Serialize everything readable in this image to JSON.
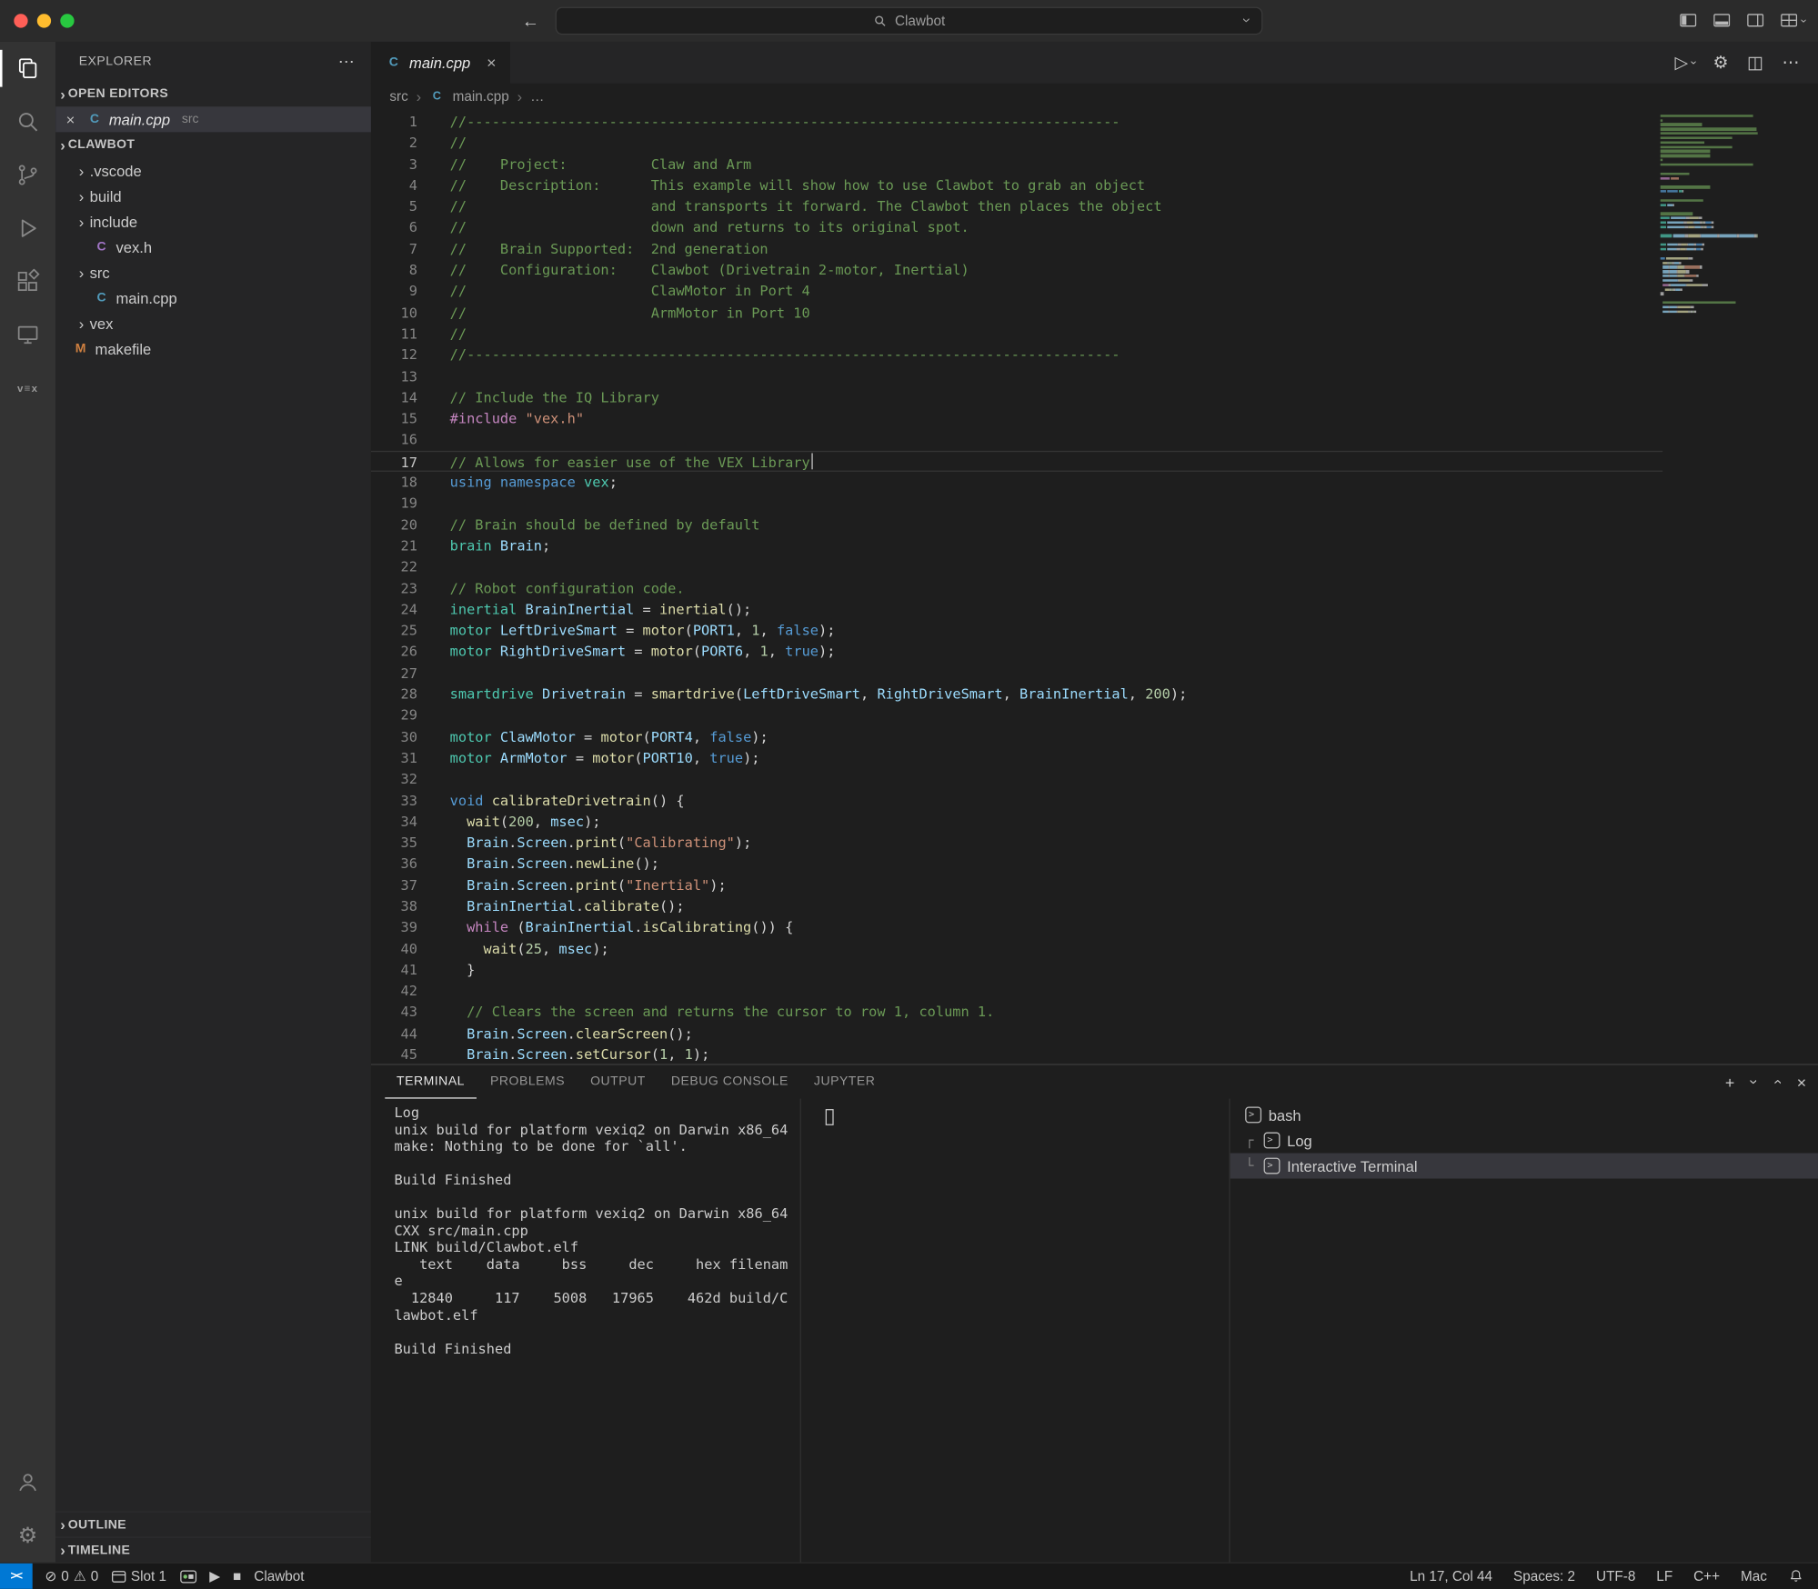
{
  "titlebar": {
    "search": "Clawbot"
  },
  "icons": {
    "chevron": "›",
    "close": "×",
    "ellipsis": "⋯",
    "back": "←",
    "forward": "→",
    "error": "⊘",
    "warning": "⚠",
    "gear": "⚙",
    "play": "▶",
    "stop": "■",
    "plus": "+",
    "split": "◫",
    "run": "▷",
    "vex": "v≡x",
    "prompt": ">"
  },
  "file_icon_letters": {
    "cpp": "C",
    "h": "C",
    "make": "M"
  },
  "colors": {
    "statusbar_bg": "#181818",
    "accent": "#0078d4",
    "selection": "#37373d",
    "comment": "#6A9955",
    "keyword": "#569CD6",
    "control": "#C586C0",
    "type": "#4EC9B0",
    "variable": "#9CDCFE",
    "function": "#DCDCAA",
    "number": "#B5CEA8",
    "string": "#CE9178",
    "traffic_red": "#ff5f57",
    "traffic_yellow": "#febc2e",
    "traffic_green": "#28c840"
  },
  "sidebar": {
    "title": "EXPLORER",
    "open_editors_label": "OPEN EDITORS",
    "open_editor": {
      "name": "main.cpp",
      "detail": "src"
    },
    "project": "CLAWBOT",
    "tree": [
      {
        "kind": "folder",
        "label": ".vscode",
        "depth": 1,
        "open": false
      },
      {
        "kind": "folder",
        "label": "build",
        "depth": 1,
        "open": false
      },
      {
        "kind": "folder",
        "label": "include",
        "depth": 1,
        "open": true
      },
      {
        "kind": "file",
        "label": "vex.h",
        "depth": 2,
        "icon": "h"
      },
      {
        "kind": "folder",
        "label": "src",
        "depth": 1,
        "open": true
      },
      {
        "kind": "file",
        "label": "main.cpp",
        "depth": 2,
        "icon": "cpp"
      },
      {
        "kind": "folder",
        "label": "vex",
        "depth": 1,
        "open": false
      },
      {
        "kind": "file",
        "label": "makefile",
        "depth": 1,
        "icon": "make"
      }
    ],
    "bottom_sections": [
      "OUTLINE",
      "TIMELINE"
    ]
  },
  "editor": {
    "tab_name": "main.cpp",
    "breadcrumb": [
      "src",
      "main.cpp",
      "…"
    ],
    "current_line": 17,
    "code": [
      {
        "n": 1,
        "s": [
          [
            "c",
            "//------------------------------------------------------------------------------"
          ]
        ]
      },
      {
        "n": 2,
        "s": [
          [
            "c",
            "//"
          ]
        ]
      },
      {
        "n": 3,
        "s": [
          [
            "c",
            "//    Project:          Claw and Arm"
          ]
        ]
      },
      {
        "n": 4,
        "s": [
          [
            "c",
            "//    Description:      This example will show how to use Clawbot to grab an object"
          ]
        ]
      },
      {
        "n": 5,
        "s": [
          [
            "c",
            "//                      and transports it forward. The Clawbot then places the object"
          ]
        ]
      },
      {
        "n": 6,
        "s": [
          [
            "c",
            "//                      down and returns to its original spot."
          ]
        ]
      },
      {
        "n": 7,
        "s": [
          [
            "c",
            "//    Brain Supported:  2nd generation"
          ]
        ]
      },
      {
        "n": 8,
        "s": [
          [
            "c",
            "//    Configuration:    Clawbot (Drivetrain 2-motor, Inertial)"
          ]
        ]
      },
      {
        "n": 9,
        "s": [
          [
            "c",
            "//                      ClawMotor in Port 4"
          ]
        ]
      },
      {
        "n": 10,
        "s": [
          [
            "c",
            "//                      ArmMotor in Port 10"
          ]
        ]
      },
      {
        "n": 11,
        "s": [
          [
            "c",
            "//"
          ]
        ]
      },
      {
        "n": 12,
        "s": [
          [
            "c",
            "//------------------------------------------------------------------------------"
          ]
        ]
      },
      {
        "n": 13,
        "s": []
      },
      {
        "n": 14,
        "s": [
          [
            "c",
            "// Include the IQ Library"
          ]
        ]
      },
      {
        "n": 15,
        "s": [
          [
            "p",
            "#include"
          ],
          [
            "d",
            " "
          ],
          [
            "s",
            "\"vex.h\""
          ]
        ]
      },
      {
        "n": 16,
        "s": []
      },
      {
        "n": 17,
        "s": [
          [
            "c",
            "// Allows for easier use of the VEX Library"
          ]
        ]
      },
      {
        "n": 18,
        "s": [
          [
            "k",
            "using"
          ],
          [
            "d",
            " "
          ],
          [
            "k",
            "namespace"
          ],
          [
            "d",
            " "
          ],
          [
            "t",
            "vex"
          ],
          [
            "d",
            ";"
          ]
        ]
      },
      {
        "n": 19,
        "s": []
      },
      {
        "n": 20,
        "s": [
          [
            "c",
            "// Brain should be defined by default"
          ]
        ]
      },
      {
        "n": 21,
        "s": [
          [
            "t",
            "brain"
          ],
          [
            "d",
            " "
          ],
          [
            "v",
            "Brain"
          ],
          [
            "d",
            ";"
          ]
        ]
      },
      {
        "n": 22,
        "s": []
      },
      {
        "n": 23,
        "s": [
          [
            "c",
            "// Robot configuration code."
          ]
        ]
      },
      {
        "n": 24,
        "s": [
          [
            "t",
            "inertial"
          ],
          [
            "d",
            " "
          ],
          [
            "v",
            "BrainInertial"
          ],
          [
            "d",
            " = "
          ],
          [
            "f",
            "inertial"
          ],
          [
            "d",
            "();"
          ]
        ]
      },
      {
        "n": 25,
        "s": [
          [
            "t",
            "motor"
          ],
          [
            "d",
            " "
          ],
          [
            "v",
            "LeftDriveSmart"
          ],
          [
            "d",
            " = "
          ],
          [
            "f",
            "motor"
          ],
          [
            "d",
            "("
          ],
          [
            "v",
            "PORT1"
          ],
          [
            "d",
            ", "
          ],
          [
            "n",
            "1"
          ],
          [
            "d",
            ", "
          ],
          [
            "k",
            "false"
          ],
          [
            "d",
            ");"
          ]
        ]
      },
      {
        "n": 26,
        "s": [
          [
            "t",
            "motor"
          ],
          [
            "d",
            " "
          ],
          [
            "v",
            "RightDriveSmart"
          ],
          [
            "d",
            " = "
          ],
          [
            "f",
            "motor"
          ],
          [
            "d",
            "("
          ],
          [
            "v",
            "PORT6"
          ],
          [
            "d",
            ", "
          ],
          [
            "n",
            "1"
          ],
          [
            "d",
            ", "
          ],
          [
            "k",
            "true"
          ],
          [
            "d",
            ");"
          ]
        ]
      },
      {
        "n": 27,
        "s": []
      },
      {
        "n": 28,
        "s": [
          [
            "t",
            "smartdrive"
          ],
          [
            "d",
            " "
          ],
          [
            "v",
            "Drivetrain"
          ],
          [
            "d",
            " = "
          ],
          [
            "f",
            "smartdrive"
          ],
          [
            "d",
            "("
          ],
          [
            "v",
            "LeftDriveSmart"
          ],
          [
            "d",
            ", "
          ],
          [
            "v",
            "RightDriveSmart"
          ],
          [
            "d",
            ", "
          ],
          [
            "v",
            "BrainInertial"
          ],
          [
            "d",
            ", "
          ],
          [
            "n",
            "200"
          ],
          [
            "d",
            ");"
          ]
        ]
      },
      {
        "n": 29,
        "s": []
      },
      {
        "n": 30,
        "s": [
          [
            "t",
            "motor"
          ],
          [
            "d",
            " "
          ],
          [
            "v",
            "ClawMotor"
          ],
          [
            "d",
            " = "
          ],
          [
            "f",
            "motor"
          ],
          [
            "d",
            "("
          ],
          [
            "v",
            "PORT4"
          ],
          [
            "d",
            ", "
          ],
          [
            "k",
            "false"
          ],
          [
            "d",
            ");"
          ]
        ]
      },
      {
        "n": 31,
        "s": [
          [
            "t",
            "motor"
          ],
          [
            "d",
            " "
          ],
          [
            "v",
            "ArmMotor"
          ],
          [
            "d",
            " = "
          ],
          [
            "f",
            "motor"
          ],
          [
            "d",
            "("
          ],
          [
            "v",
            "PORT10"
          ],
          [
            "d",
            ", "
          ],
          [
            "k",
            "true"
          ],
          [
            "d",
            ");"
          ]
        ]
      },
      {
        "n": 32,
        "s": []
      },
      {
        "n": 33,
        "s": [
          [
            "k",
            "void"
          ],
          [
            "d",
            " "
          ],
          [
            "f",
            "calibrateDrivetrain"
          ],
          [
            "d",
            "() {"
          ]
        ]
      },
      {
        "n": 34,
        "s": [
          [
            "d",
            "  "
          ],
          [
            "f",
            "wait"
          ],
          [
            "d",
            "("
          ],
          [
            "n",
            "200"
          ],
          [
            "d",
            ", "
          ],
          [
            "v",
            "msec"
          ],
          [
            "d",
            ");"
          ]
        ]
      },
      {
        "n": 35,
        "s": [
          [
            "d",
            "  "
          ],
          [
            "v",
            "Brain"
          ],
          [
            "d",
            "."
          ],
          [
            "v",
            "Screen"
          ],
          [
            "d",
            "."
          ],
          [
            "f",
            "print"
          ],
          [
            "d",
            "("
          ],
          [
            "s",
            "\"Calibrating\""
          ],
          [
            "d",
            ");"
          ]
        ]
      },
      {
        "n": 36,
        "s": [
          [
            "d",
            "  "
          ],
          [
            "v",
            "Brain"
          ],
          [
            "d",
            "."
          ],
          [
            "v",
            "Screen"
          ],
          [
            "d",
            "."
          ],
          [
            "f",
            "newLine"
          ],
          [
            "d",
            "();"
          ]
        ]
      },
      {
        "n": 37,
        "s": [
          [
            "d",
            "  "
          ],
          [
            "v",
            "Brain"
          ],
          [
            "d",
            "."
          ],
          [
            "v",
            "Screen"
          ],
          [
            "d",
            "."
          ],
          [
            "f",
            "print"
          ],
          [
            "d",
            "("
          ],
          [
            "s",
            "\"Inertial\""
          ],
          [
            "d",
            ");"
          ]
        ]
      },
      {
        "n": 38,
        "s": [
          [
            "d",
            "  "
          ],
          [
            "v",
            "BrainInertial"
          ],
          [
            "d",
            "."
          ],
          [
            "f",
            "calibrate"
          ],
          [
            "d",
            "();"
          ]
        ]
      },
      {
        "n": 39,
        "s": [
          [
            "d",
            "  "
          ],
          [
            "p",
            "while"
          ],
          [
            "d",
            " ("
          ],
          [
            "v",
            "BrainInertial"
          ],
          [
            "d",
            "."
          ],
          [
            "f",
            "isCalibrating"
          ],
          [
            "d",
            "()) {"
          ]
        ]
      },
      {
        "n": 40,
        "s": [
          [
            "d",
            "    "
          ],
          [
            "f",
            "wait"
          ],
          [
            "d",
            "("
          ],
          [
            "n",
            "25"
          ],
          [
            "d",
            ", "
          ],
          [
            "v",
            "msec"
          ],
          [
            "d",
            ");"
          ]
        ]
      },
      {
        "n": 41,
        "s": [
          [
            "d",
            "  }"
          ]
        ]
      },
      {
        "n": 42,
        "s": []
      },
      {
        "n": 43,
        "s": [
          [
            "d",
            "  "
          ],
          [
            "c",
            "// Clears the screen and returns the cursor to row 1, column 1."
          ]
        ]
      },
      {
        "n": 44,
        "s": [
          [
            "d",
            "  "
          ],
          [
            "v",
            "Brain"
          ],
          [
            "d",
            "."
          ],
          [
            "v",
            "Screen"
          ],
          [
            "d",
            "."
          ],
          [
            "f",
            "clearScreen"
          ],
          [
            "d",
            "();"
          ]
        ]
      },
      {
        "n": 45,
        "s": [
          [
            "d",
            "  "
          ],
          [
            "v",
            "Brain"
          ],
          [
            "d",
            "."
          ],
          [
            "v",
            "Screen"
          ],
          [
            "d",
            "."
          ],
          [
            "f",
            "setCursor"
          ],
          [
            "d",
            "("
          ],
          [
            "n",
            "1"
          ],
          [
            "d",
            ", "
          ],
          [
            "n",
            "1"
          ],
          [
            "d",
            ");"
          ]
        ]
      }
    ]
  },
  "panel": {
    "tabs": [
      "TERMINAL",
      "PROBLEMS",
      "OUTPUT",
      "DEBUG CONSOLE",
      "JUPYTER"
    ],
    "active_tab": "TERMINAL",
    "terminal_lines": [
      "Log",
      "unix build for platform vexiq2 on Darwin x86_64",
      "make: Nothing to be done for `all'.",
      "",
      "Build Finished",
      "",
      "unix build for platform vexiq2 on Darwin x86_64",
      "CXX src/main.cpp",
      "LINK build/Clawbot.elf",
      "   text    data     bss     dec     hex filenam",
      "e",
      "  12840     117    5008   17965    462d build/C",
      "lawbot.elf",
      "",
      "Build Finished"
    ],
    "terminals": [
      {
        "label": "bash",
        "prefix": "",
        "selected": false
      },
      {
        "label": "Log",
        "prefix": "┌",
        "selected": false
      },
      {
        "label": "Interactive Terminal",
        "prefix": "└",
        "selected": true
      }
    ]
  },
  "statusbar": {
    "remote_label": "><",
    "errors": "0",
    "warnings": "0",
    "slot": "Slot 1",
    "project": "Clawbot",
    "right": [
      "Ln 17, Col 44",
      "Spaces: 2",
      "UTF-8",
      "LF",
      "C++",
      "Mac"
    ]
  }
}
